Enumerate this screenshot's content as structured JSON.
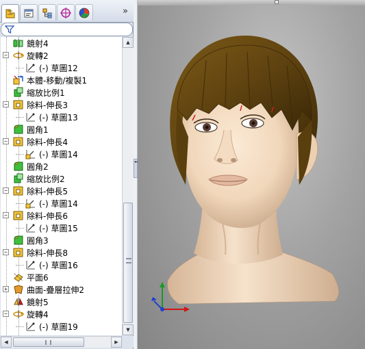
{
  "tabs": [
    {
      "icon": "feature-manager-icon",
      "active": true
    },
    {
      "icon": "property-manager-icon",
      "active": false
    },
    {
      "icon": "configuration-manager-icon",
      "active": false
    },
    {
      "icon": "dimxpert-manager-icon",
      "active": false
    },
    {
      "icon": "display-manager-icon",
      "active": false
    }
  ],
  "tab_expand_glyph": "»",
  "filter": {
    "icon": "filter-icon",
    "value": ""
  },
  "tree": {
    "items": [
      {
        "label": "鏡射4",
        "icon": "mirror-feature-icon",
        "expander": ""
      },
      {
        "label": "旋轉2",
        "icon": "revolve-feature-icon",
        "expander": "−"
      },
      {
        "label": "(-) 草圖12",
        "icon": "sketch-icon",
        "expander": ""
      },
      {
        "label": "本體-移動/複製1",
        "icon": "move-copy-body-icon",
        "expander": ""
      },
      {
        "label": "縮放比例1",
        "icon": "scale-feature-icon",
        "expander": ""
      },
      {
        "label": "除料-伸長3",
        "icon": "extruded-cut-icon",
        "expander": "−"
      },
      {
        "label": "(-) 草圖13",
        "icon": "sketch-icon",
        "expander": ""
      },
      {
        "label": "圓角1",
        "icon": "fillet-feature-icon",
        "expander": ""
      },
      {
        "label": "除料-伸長4",
        "icon": "extruded-cut-icon",
        "expander": "−"
      },
      {
        "label": "(-) 草圖14",
        "icon": "shared-sketch-icon",
        "expander": ""
      },
      {
        "label": "圓角2",
        "icon": "fillet-feature-icon",
        "expander": ""
      },
      {
        "label": "縮放比例2",
        "icon": "scale-feature-icon",
        "expander": ""
      },
      {
        "label": "除料-伸長5",
        "icon": "extruded-cut-icon",
        "expander": "−"
      },
      {
        "label": "(-) 草圖14",
        "icon": "shared-sketch-icon",
        "expander": ""
      },
      {
        "label": "除料-伸長6",
        "icon": "extruded-cut-icon",
        "expander": "−"
      },
      {
        "label": "(-) 草圖15",
        "icon": "sketch-icon",
        "expander": ""
      },
      {
        "label": "圓角3",
        "icon": "fillet-feature-icon",
        "expander": ""
      },
      {
        "label": "除料-伸長8",
        "icon": "extruded-cut-icon",
        "expander": "−"
      },
      {
        "label": "(-) 草圖16",
        "icon": "sketch-icon",
        "expander": ""
      },
      {
        "label": "平面6",
        "icon": "plane-icon",
        "expander": ""
      },
      {
        "label": "曲面-疊層拉伸2",
        "icon": "surface-loft-icon",
        "expander": "+"
      },
      {
        "label": "鏡射5",
        "icon": "mirror-body-icon",
        "expander": ""
      },
      {
        "label": "旋轉4",
        "icon": "revolve-feature-icon",
        "expander": "−"
      },
      {
        "label": "(-) 草圖19",
        "icon": "sketch-icon",
        "expander": ""
      }
    ]
  },
  "scrollbars": {
    "vertical_up": "▲",
    "vertical_down": "▼",
    "horizontal_left": "◀",
    "horizontal_right": "▶"
  },
  "splitter_glyph": "◂◂",
  "viewport": {
    "model": "head-model",
    "triad_axes": [
      "x",
      "y",
      "z"
    ]
  },
  "colors": {
    "x_axis": "#d01515",
    "y_axis": "#1a9a22",
    "z_axis": "#1f3fd0",
    "skin": "#f2dcc2",
    "hair": "#6b4a12"
  }
}
